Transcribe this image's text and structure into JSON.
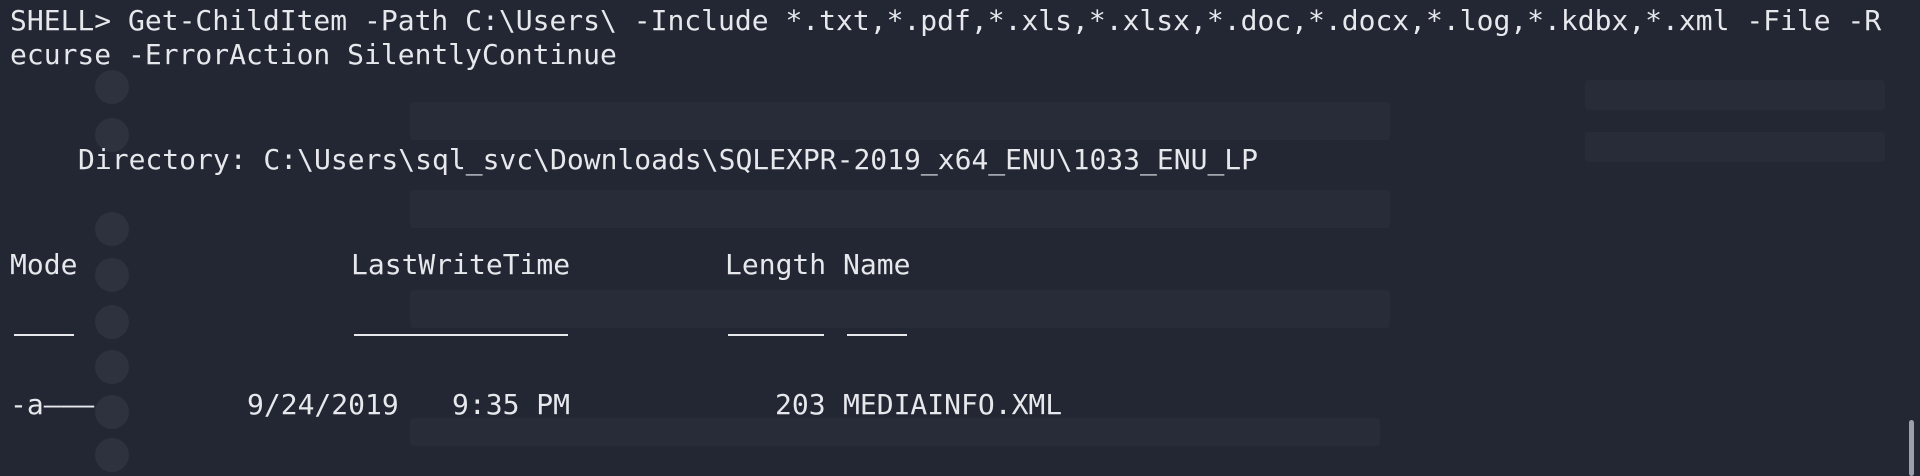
{
  "terminal": {
    "command_line_1": "SHELL> Get-ChildItem -Path C:\\Users\\ -Include *.txt,*.pdf,*.xls,*.xlsx,*.doc,*.docx,*.log,*.kdbx,*.xml -File -R",
    "command_line_2": "ecurse -ErrorAction SilentlyContinue",
    "directory_line": "Directory: C:\\Users\\sql_svc\\Downloads\\SQLEXPR-2019_x64_ENU\\1033_ENU_LP",
    "table": {
      "headers": {
        "mode": "Mode",
        "last_write_time": "LastWriteTime",
        "length": "Length",
        "name": "Name"
      },
      "rows": [
        {
          "mode": "-a———",
          "date": "9/24/2019",
          "time": "9:35 PM",
          "length": "203",
          "name": "MEDIAINFO.XML"
        }
      ]
    }
  },
  "colors": {
    "background": "#232734",
    "foreground": "#e6e8ec"
  }
}
